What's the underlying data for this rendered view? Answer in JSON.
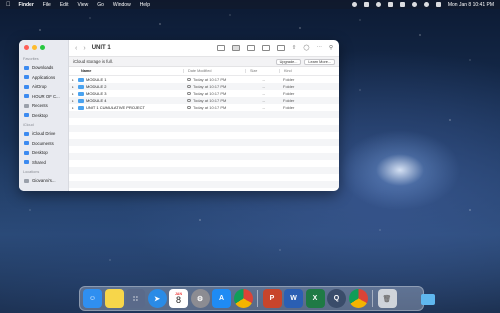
{
  "menubar": {
    "app_name": "Finder",
    "items": [
      "File",
      "Edit",
      "View",
      "Go",
      "Window",
      "Help"
    ],
    "datetime": "Mon Jan 8  10:41 PM"
  },
  "window": {
    "title": "UNIT 1",
    "banner": {
      "message": "iCloud storage is full.",
      "upgrade_label": "Upgrade...",
      "learn_more_label": "Learn More..."
    },
    "columns": {
      "name": "Name",
      "date": "Date Modified",
      "size": "Size",
      "kind": "Kind"
    },
    "rows": [
      {
        "name": "MODULE 1",
        "date": "Today at 10:17 PM",
        "size": "--",
        "kind": "Folder"
      },
      {
        "name": "MODULE 2",
        "date": "Today at 10:17 PM",
        "size": "--",
        "kind": "Folder"
      },
      {
        "name": "MODULE 3",
        "date": "Today at 10:17 PM",
        "size": "--",
        "kind": "Folder"
      },
      {
        "name": "MODULE 4",
        "date": "Today at 10:17 PM",
        "size": "--",
        "kind": "Folder"
      },
      {
        "name": "UNIT 1 CUMULATIVE PROJECT",
        "date": "Today at 10:17 PM",
        "size": "--",
        "kind": "Folder"
      }
    ]
  },
  "sidebar": {
    "sections": [
      {
        "title": "Favorites",
        "items": [
          "Downloads",
          "Applications",
          "AirDrop",
          "HOUR OF C...",
          "Recents",
          "Desktop"
        ]
      },
      {
        "title": "iCloud",
        "items": [
          "iCloud Drive",
          "Documents",
          "Desktop",
          "Shared"
        ]
      },
      {
        "title": "Locations",
        "items": [
          "Giovanni's..."
        ]
      }
    ]
  },
  "dock": {
    "calendar_month": "JAN",
    "calendar_day": "8",
    "colors": {
      "finder": "#2f8ff0",
      "notes": "#f7d64a",
      "launchpad": "#5a6a8a",
      "safari": "#2a8be6",
      "calendar": "#ffffff",
      "settings": "#8c8c92",
      "appstore": "#1f8bf4",
      "chrome": "#ffffff",
      "powerpoint": "#c8452b",
      "word": "#2b5fb3",
      "excel": "#1f7a45",
      "quicktime": "#3a4c6a",
      "trash": "#cfd4da"
    }
  }
}
